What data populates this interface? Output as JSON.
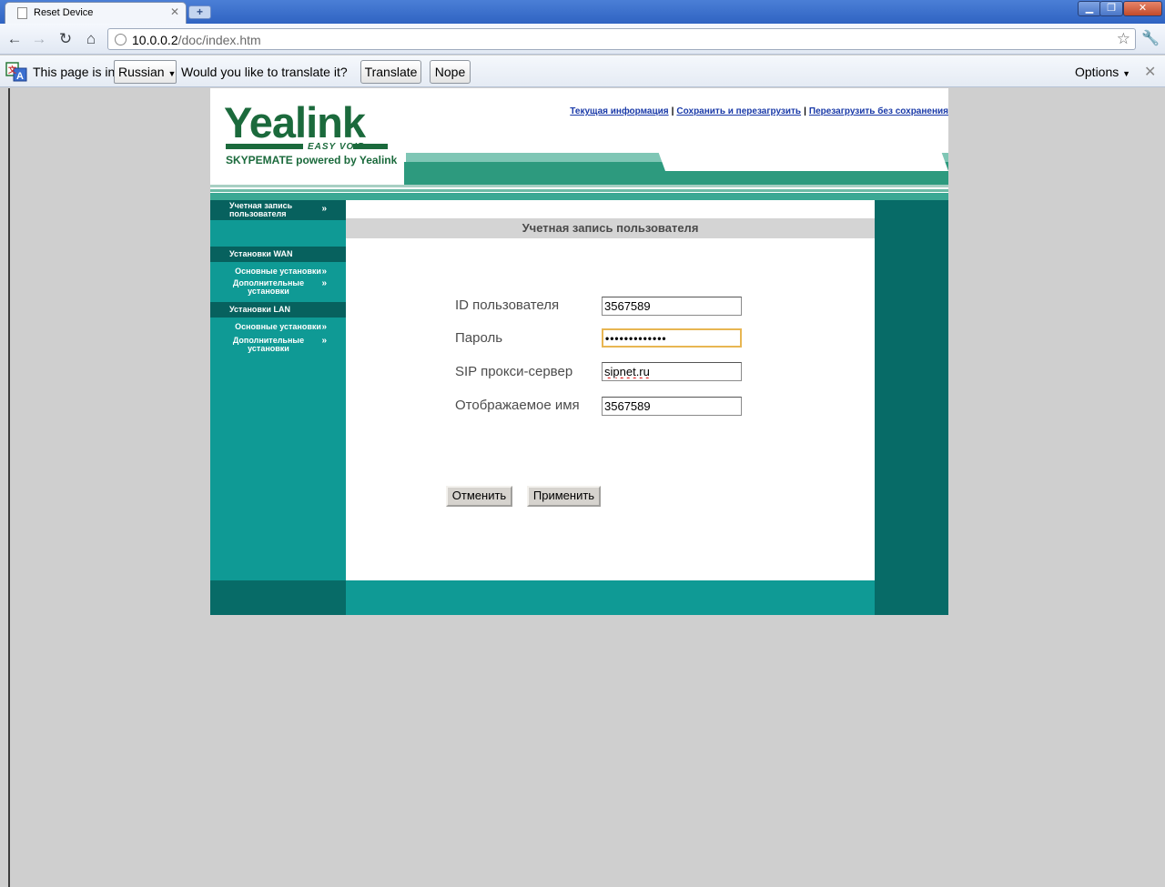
{
  "browser": {
    "tab_title": "Reset Device",
    "url_host": "10.0.0.2",
    "url_path": "/doc/index.htm"
  },
  "infobar": {
    "text_prefix": "This page is in",
    "language": "Russian",
    "question": "Would you like to translate it?",
    "translate_label": "Translate",
    "nope_label": "Nope",
    "options_label": "Options"
  },
  "header": {
    "logo_word": "Yealink",
    "logo_easy": "EASY VOIP",
    "logo_tagline": "SKYPEMATE powered by Yealink",
    "links": [
      "Текущая информация",
      "Сохранить и перезагрузить",
      "Перезагрузить без сохранения"
    ]
  },
  "sidebar": {
    "account": "Учетная запись пользователя",
    "wan_heading": "Установки WAN",
    "wan_items": [
      "Основные установки",
      "Дополнительные установки"
    ],
    "lan_heading": "Установки LAN",
    "lan_items": [
      "Основные установки",
      "Дополнительные установки"
    ]
  },
  "main": {
    "title": "Учетная запись пользователя",
    "fields": [
      {
        "label": "ID пользователя",
        "value": "3567589"
      },
      {
        "label": "Пароль",
        "value": "•••••••••••••"
      },
      {
        "label": "SIP прокси-сервер",
        "value": "sipnet.ru"
      },
      {
        "label": "Отображаемое имя",
        "value": "3567589"
      }
    ],
    "cancel_label": "Отменить",
    "apply_label": "Применить"
  },
  "colors": {
    "sidebar": "#0f9a95",
    "sidebar_dark": "#07615e",
    "brand_green": "#1b6a3c",
    "focus_border": "#e8b652"
  }
}
